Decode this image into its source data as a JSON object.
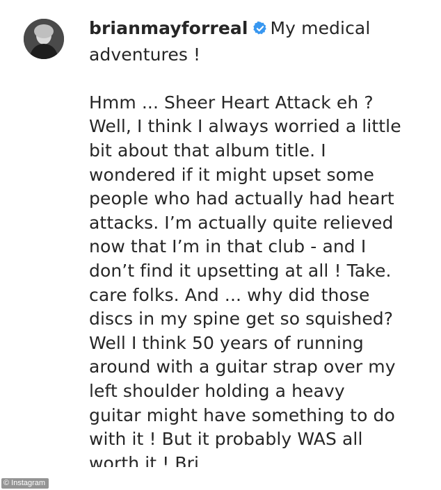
{
  "post": {
    "username": "brianmayforreal",
    "verified_icon": "verified-badge-icon",
    "verified_color": "#3897f0",
    "title": "My medical adventures !",
    "body_lines": [
      "Hmm ... Sheer Heart Attack eh ?",
      "Well, I think I always worried a little",
      "bit about that album title. I",
      "wondered if it might upset some",
      "people who had actually had heart",
      "attacks. I’m actually quite relieved",
      "now that I’m in that club - and I",
      "don’t find it upsetting at all ! Take.",
      "care folks. And ... why did those",
      "discs in my spine get so squished?",
      "Well I think 50 years of running",
      "around with a guitar strap over my",
      "left shoulder holding a heavy",
      "guitar might have something to do",
      "with it ! But it probably WAS all",
      "worth it ! Bri"
    ]
  },
  "watermark": {
    "text": "© Instagram"
  }
}
